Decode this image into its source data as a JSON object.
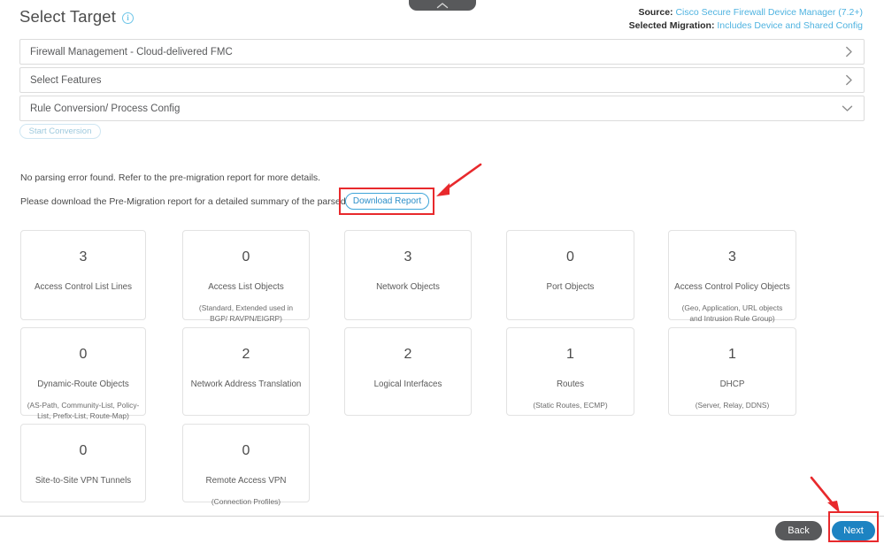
{
  "header": {
    "title": "Select Target",
    "info_icon": "info-icon",
    "source_label": "Source:",
    "source_value": "Cisco Secure Firewall Device Manager (7.2+)",
    "migration_label": "Selected Migration:",
    "migration_value": "Includes Device and Shared Config",
    "collapse_handle_icon": "chevron-up-icon"
  },
  "accordions": [
    {
      "label": "Firewall Management - Cloud-delivered FMC",
      "icon": "chevron-right-icon"
    },
    {
      "label": "Select Features",
      "icon": "chevron-right-icon"
    },
    {
      "label": "Rule Conversion/ Process Config",
      "icon": "chevron-down-icon"
    }
  ],
  "actions": {
    "start_conversion": "Start Conversion",
    "download_report": "Download Report"
  },
  "messages": {
    "parsing_status": "No parsing error found. Refer to the pre-migration report for more details.",
    "download_prompt": "Please download the Pre-Migration report for a detailed summary of the parsed configuration."
  },
  "cards": [
    {
      "value": "3",
      "name": "Access Control List Lines",
      "sub": ""
    },
    {
      "value": "0",
      "name": "Access List Objects",
      "sub": "(Standard, Extended used in BGP/ RAVPN/EIGRP)"
    },
    {
      "value": "3",
      "name": "Network Objects",
      "sub": ""
    },
    {
      "value": "0",
      "name": "Port Objects",
      "sub": ""
    },
    {
      "value": "3",
      "name": "Access Control Policy Objects",
      "sub": "(Geo, Application, URL objects and Intrusion Rule Group)"
    },
    {
      "value": "0",
      "name": "Dynamic-Route Objects",
      "sub": "(AS-Path, Community-List, Policy-List, Prefix-List, Route-Map)"
    },
    {
      "value": "2",
      "name": "Network Address Translation",
      "sub": ""
    },
    {
      "value": "2",
      "name": "Logical Interfaces",
      "sub": ""
    },
    {
      "value": "1",
      "name": "Routes",
      "sub": "(Static Routes, ECMP)"
    },
    {
      "value": "1",
      "name": "DHCP",
      "sub": "(Server, Relay, DDNS)"
    },
    {
      "value": "0",
      "name": "Site-to-Site VPN Tunnels",
      "sub": ""
    },
    {
      "value": "0",
      "name": "Remote Access VPN",
      "sub": "(Connection Profiles)"
    }
  ],
  "footer": {
    "back": "Back",
    "next": "Next"
  },
  "colors": {
    "link": "#4fb3e0",
    "primary_button": "#1d83c2",
    "secondary_button": "#58595b",
    "annotation": "#e8292c"
  }
}
